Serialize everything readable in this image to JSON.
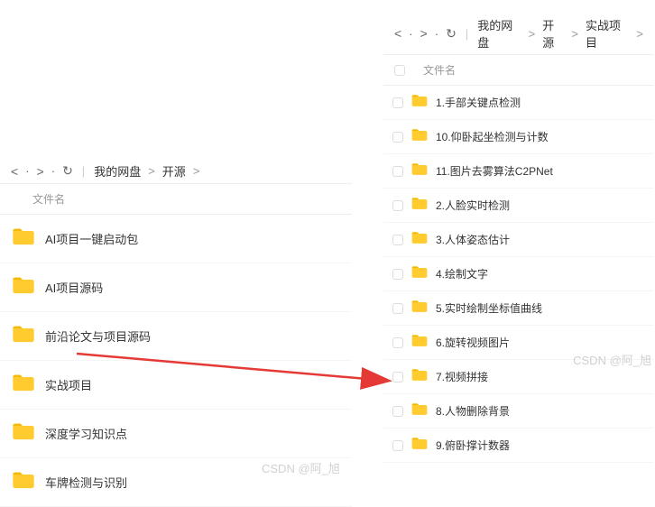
{
  "nav": {
    "back": "<",
    "forward": ">",
    "refresh": "↻",
    "bar": "|",
    "gt": ">"
  },
  "left": {
    "breadcrumb": [
      "我的网盘",
      "开源"
    ],
    "column_header": "文件名",
    "items": [
      "AI项目一键启动包",
      "AI项目源码",
      "前沿论文与项目源码",
      "实战项目",
      "深度学习知识点",
      "车牌检测与识别"
    ]
  },
  "right": {
    "breadcrumb": [
      "我的网盘",
      "开源",
      "实战项目"
    ],
    "column_header": "文件名",
    "items": [
      "1.手部关键点检测",
      "10.仰卧起坐检测与计数",
      "11.图片去雾算法C2PNet",
      "2.人脸实时检测",
      "3.人体姿态估计",
      "4.绘制文字",
      "5.实时绘制坐标值曲线",
      "6.旋转视频图片",
      "7.视频拼接",
      "8.人物删除背景",
      "9.俯卧撑计数器"
    ]
  },
  "watermark": "CSDN @阿_旭",
  "icons": {
    "folder_fill_big": "#FFCB2F",
    "folder_fill_small": "#FFCB2F",
    "folder_tab": "#F5B800"
  }
}
